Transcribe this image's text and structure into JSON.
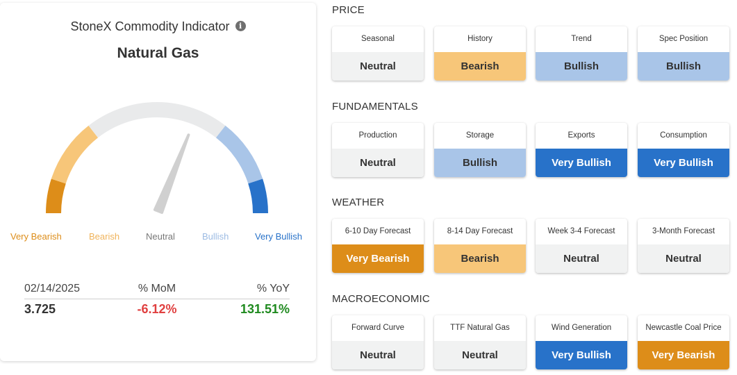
{
  "indicator": {
    "title": "StoneX Commodity Indicator",
    "commodity": "Natural Gas",
    "info_icon": "info-icon",
    "gauge_level": 0.62,
    "gauge_labels": [
      "Very Bearish",
      "Bearish",
      "Neutral",
      "Bullish",
      "Very Bullish"
    ],
    "stats": {
      "date": "02/14/2025",
      "mom_label": "% MoM",
      "yoy_label": "% YoY",
      "price": "3.725",
      "mom": "-6.12%",
      "yoy": "131.51%"
    }
  },
  "colors": {
    "very_bearish": "#dd8d19",
    "bearish": "#f7c679",
    "neutral": "#e9eaeb",
    "bullish": "#a9c5e8",
    "very_bullish": "#2872c9",
    "negative": "#e04040",
    "positive": "#1f8a1f",
    "needle": "#d0d0d0"
  },
  "sections": [
    {
      "heading": "PRICE",
      "tiles": [
        {
          "label": "Seasonal",
          "value": "Neutral",
          "rating": "neutral"
        },
        {
          "label": "History",
          "value": "Bearish",
          "rating": "bearish"
        },
        {
          "label": "Trend",
          "value": "Bullish",
          "rating": "bullish"
        },
        {
          "label": "Spec Position",
          "value": "Bullish",
          "rating": "bullish"
        }
      ]
    },
    {
      "heading": "FUNDAMENTALS",
      "tiles": [
        {
          "label": "Production",
          "value": "Neutral",
          "rating": "neutral"
        },
        {
          "label": "Storage",
          "value": "Bullish",
          "rating": "bullish"
        },
        {
          "label": "Exports",
          "value": "Very Bullish",
          "rating": "very_bullish"
        },
        {
          "label": "Consumption",
          "value": "Very Bullish",
          "rating": "very_bullish"
        }
      ]
    },
    {
      "heading": "WEATHER",
      "tiles": [
        {
          "label": "6-10 Day Forecast",
          "value": "Very Bearish",
          "rating": "very_bearish"
        },
        {
          "label": "8-14 Day Forecast",
          "value": "Bearish",
          "rating": "bearish"
        },
        {
          "label": "Week 3-4 Forecast",
          "value": "Neutral",
          "rating": "neutral"
        },
        {
          "label": "3-Month Forecast",
          "value": "Neutral",
          "rating": "neutral"
        }
      ]
    },
    {
      "heading": "MACROECONOMIC",
      "tiles": [
        {
          "label": "Forward Curve",
          "value": "Neutral",
          "rating": "neutral"
        },
        {
          "label": "TTF Natural Gas",
          "value": "Neutral",
          "rating": "neutral"
        },
        {
          "label": "Wind Generation",
          "value": "Very Bullish",
          "rating": "very_bullish"
        },
        {
          "label": "Newcastle Coal Price",
          "value": "Very Bearish",
          "rating": "very_bearish"
        }
      ]
    }
  ]
}
